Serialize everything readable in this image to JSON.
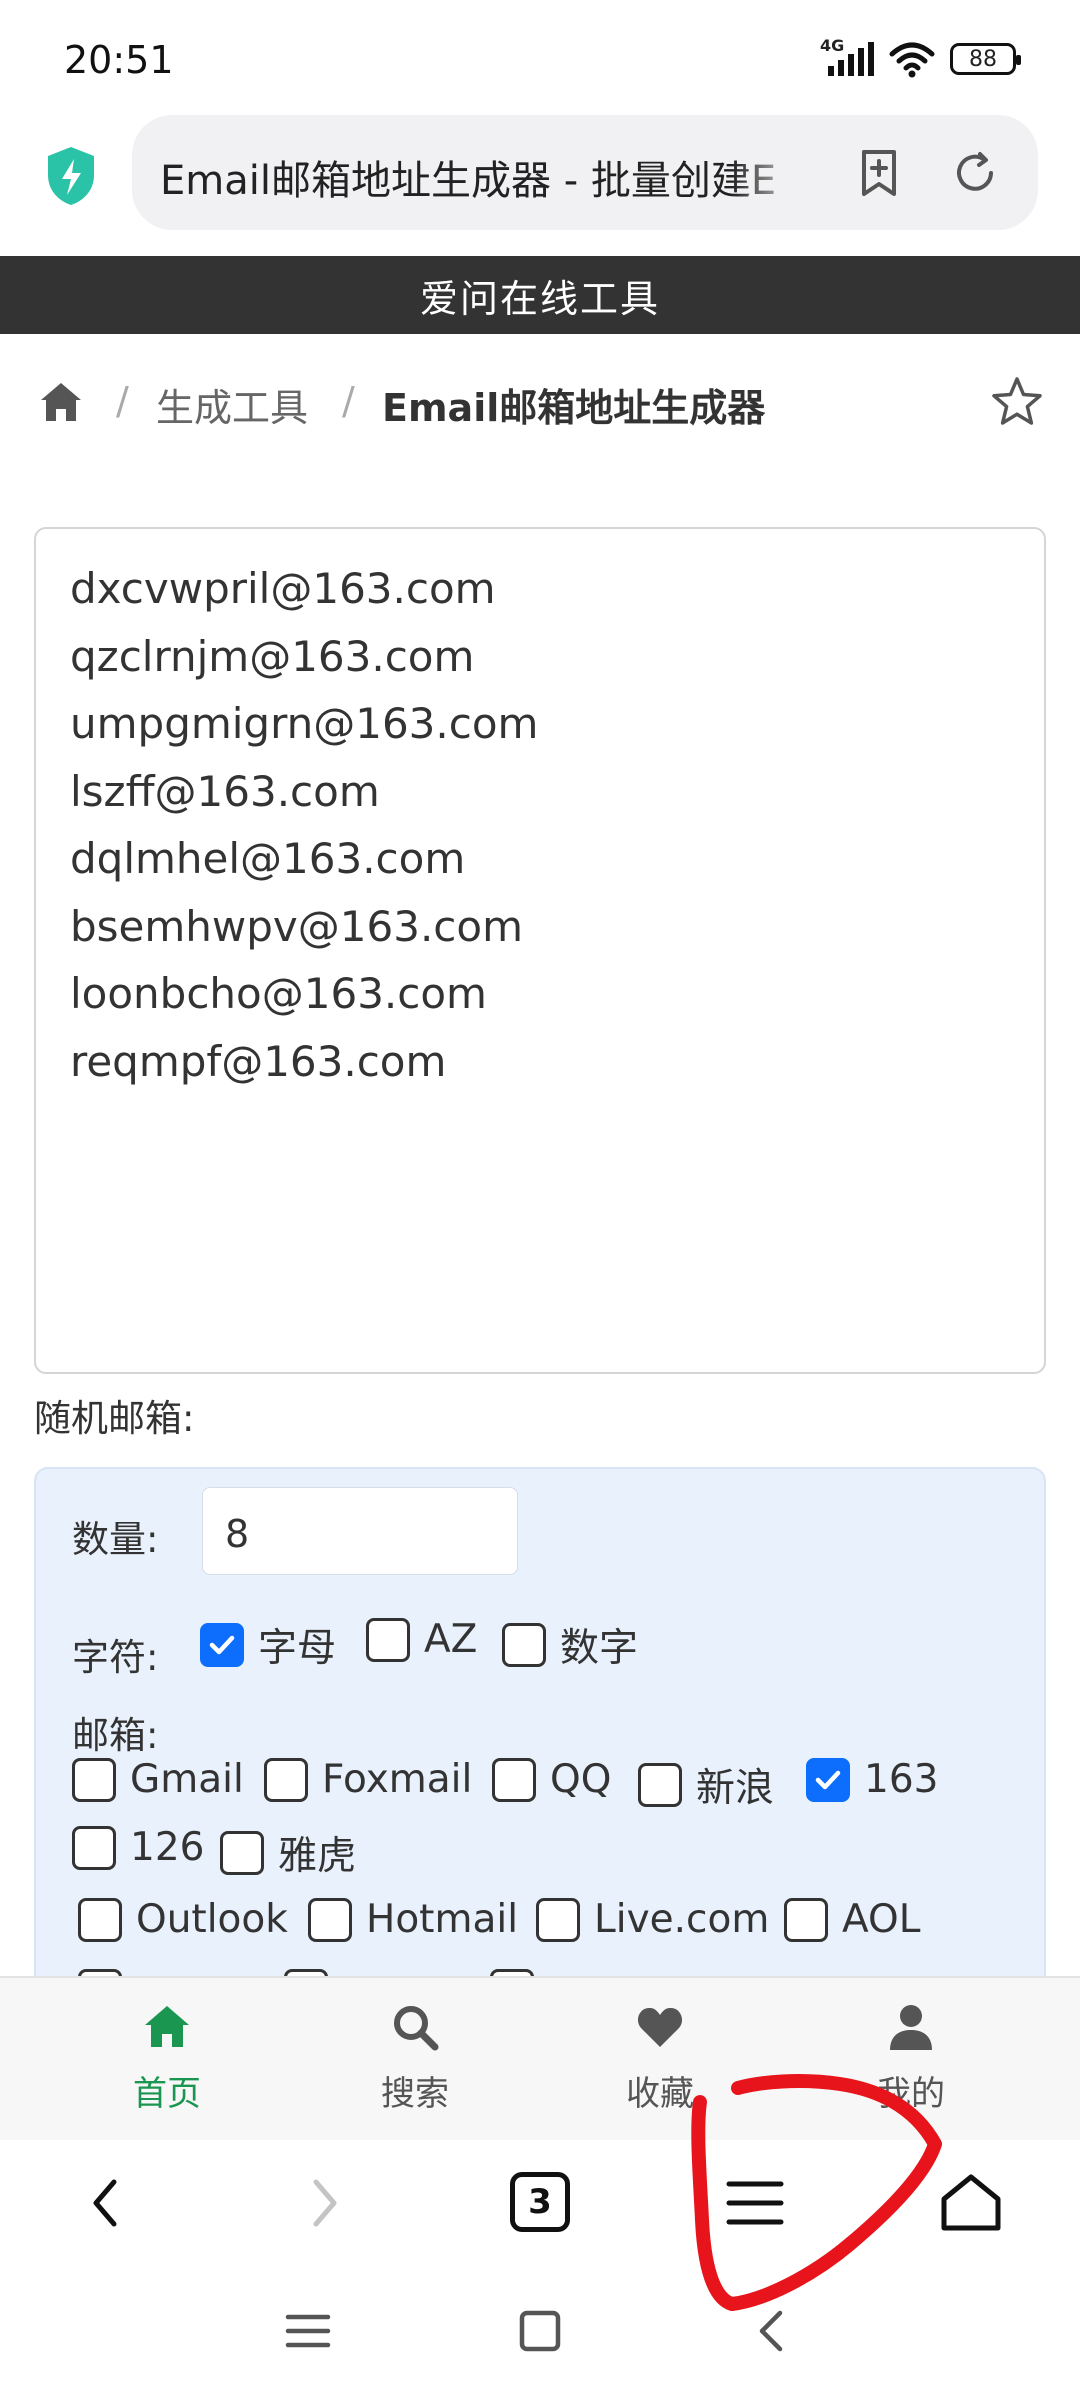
{
  "status_bar": {
    "time": "20:51",
    "network": "4G",
    "battery": "88"
  },
  "browser": {
    "address_text": "Email邮箱地址生成器 - 批量创建E",
    "tabs_count": "3"
  },
  "header": {
    "site_title": "爱问在线工具"
  },
  "breadcrumb": {
    "parent": "生成工具",
    "current": "Email邮箱地址生成器",
    "separator": "/"
  },
  "results": [
    "dxcvwpril@163.com",
    "qzclrnjm@163.com",
    "umpgmigrn@163.com",
    "lszff@163.com",
    "dqlmhel@163.com",
    "bsemhwpv@163.com",
    "loonbcho@163.com",
    "reqmpf@163.com"
  ],
  "section_label": "随机邮箱:",
  "options": {
    "quantity_label": "数量:",
    "quantity_value": "8",
    "chars_label": "字符:",
    "chars": [
      {
        "label": "字母",
        "checked": true
      },
      {
        "label": "AZ",
        "checked": false
      },
      {
        "label": "数字",
        "checked": false
      }
    ],
    "mailbox_label": "邮箱:",
    "providers": [
      {
        "label": "Gmail",
        "checked": false
      },
      {
        "label": "Foxmail",
        "checked": false
      },
      {
        "label": "QQ",
        "checked": false
      },
      {
        "label": "新浪",
        "checked": false
      },
      {
        "label": "163",
        "checked": true
      },
      {
        "label": "126",
        "checked": false
      },
      {
        "label": "雅虎",
        "checked": false
      },
      {
        "label": "Outlook",
        "checked": false
      },
      {
        "label": "Hotmail",
        "checked": false
      },
      {
        "label": "Live.com",
        "checked": false
      },
      {
        "label": "AOL",
        "checked": false
      }
    ]
  },
  "site_nav": [
    {
      "label": "首页",
      "icon": "home-icon",
      "active": true
    },
    {
      "label": "搜索",
      "icon": "search-icon",
      "active": false
    },
    {
      "label": "收藏",
      "icon": "heart-icon",
      "active": false
    },
    {
      "label": "我的",
      "icon": "user-icon",
      "active": false
    }
  ],
  "colors": {
    "accent_green": "#1a9651",
    "checkbox_blue": "#0d6efd",
    "header_bg": "#333333",
    "panel_bg": "#e8f1fc",
    "annotation_red": "#e8141b"
  }
}
